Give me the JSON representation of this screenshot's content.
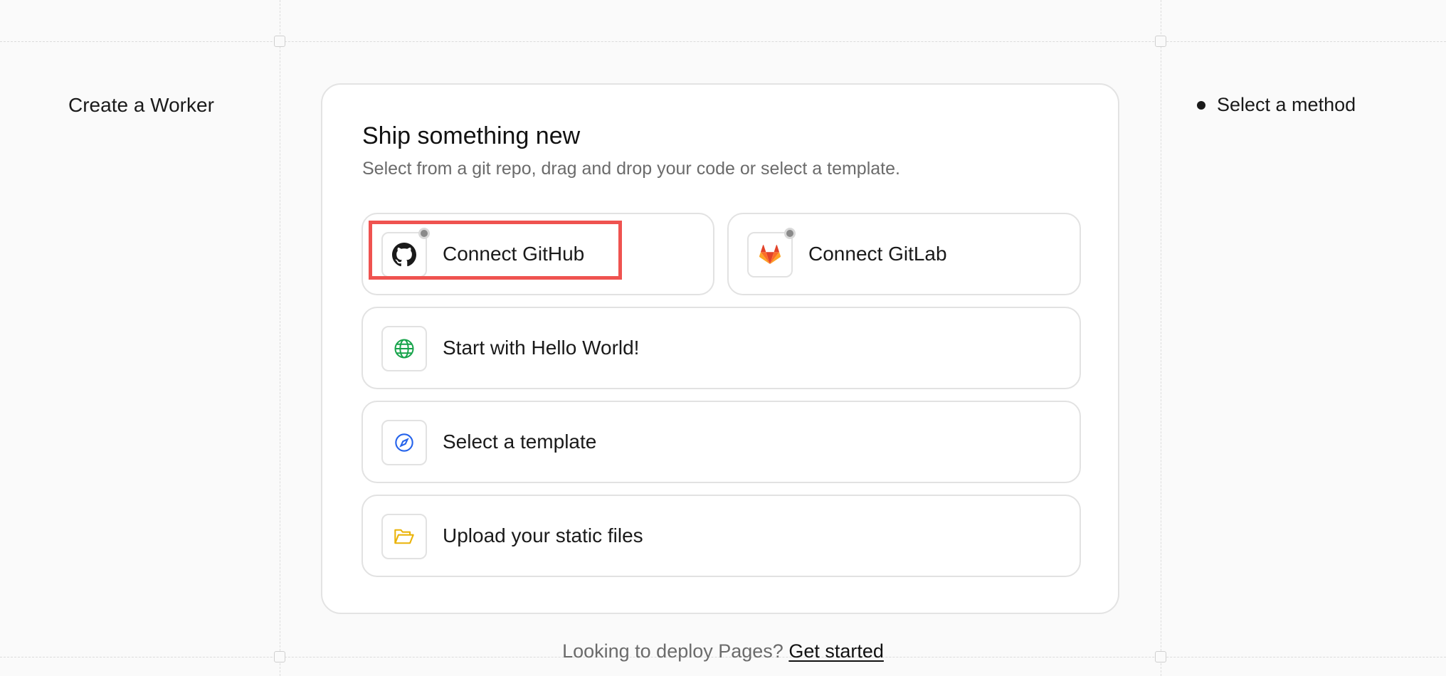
{
  "sidebar": {
    "title": "Create a Worker"
  },
  "steps": [
    {
      "label": "Select a method"
    }
  ],
  "card": {
    "title": "Ship something new",
    "subtitle": "Select from a git repo, drag and drop your code or select a template."
  },
  "options": [
    {
      "label": "Connect GitHub",
      "icon": "github-icon"
    },
    {
      "label": "Connect GitLab",
      "icon": "gitlab-icon"
    },
    {
      "label": "Start with Hello World!",
      "icon": "globe-icon"
    },
    {
      "label": "Select a template",
      "icon": "compass-icon"
    },
    {
      "label": "Upload your static files",
      "icon": "folder-icon"
    }
  ],
  "footer": {
    "text": "Looking to deploy Pages?",
    "link": "Get started"
  },
  "colors": {
    "highlight": "#ef5350",
    "globe": "#16a34a",
    "compass": "#2563eb",
    "folder": "#eab308",
    "gitlab": "#e24329"
  }
}
